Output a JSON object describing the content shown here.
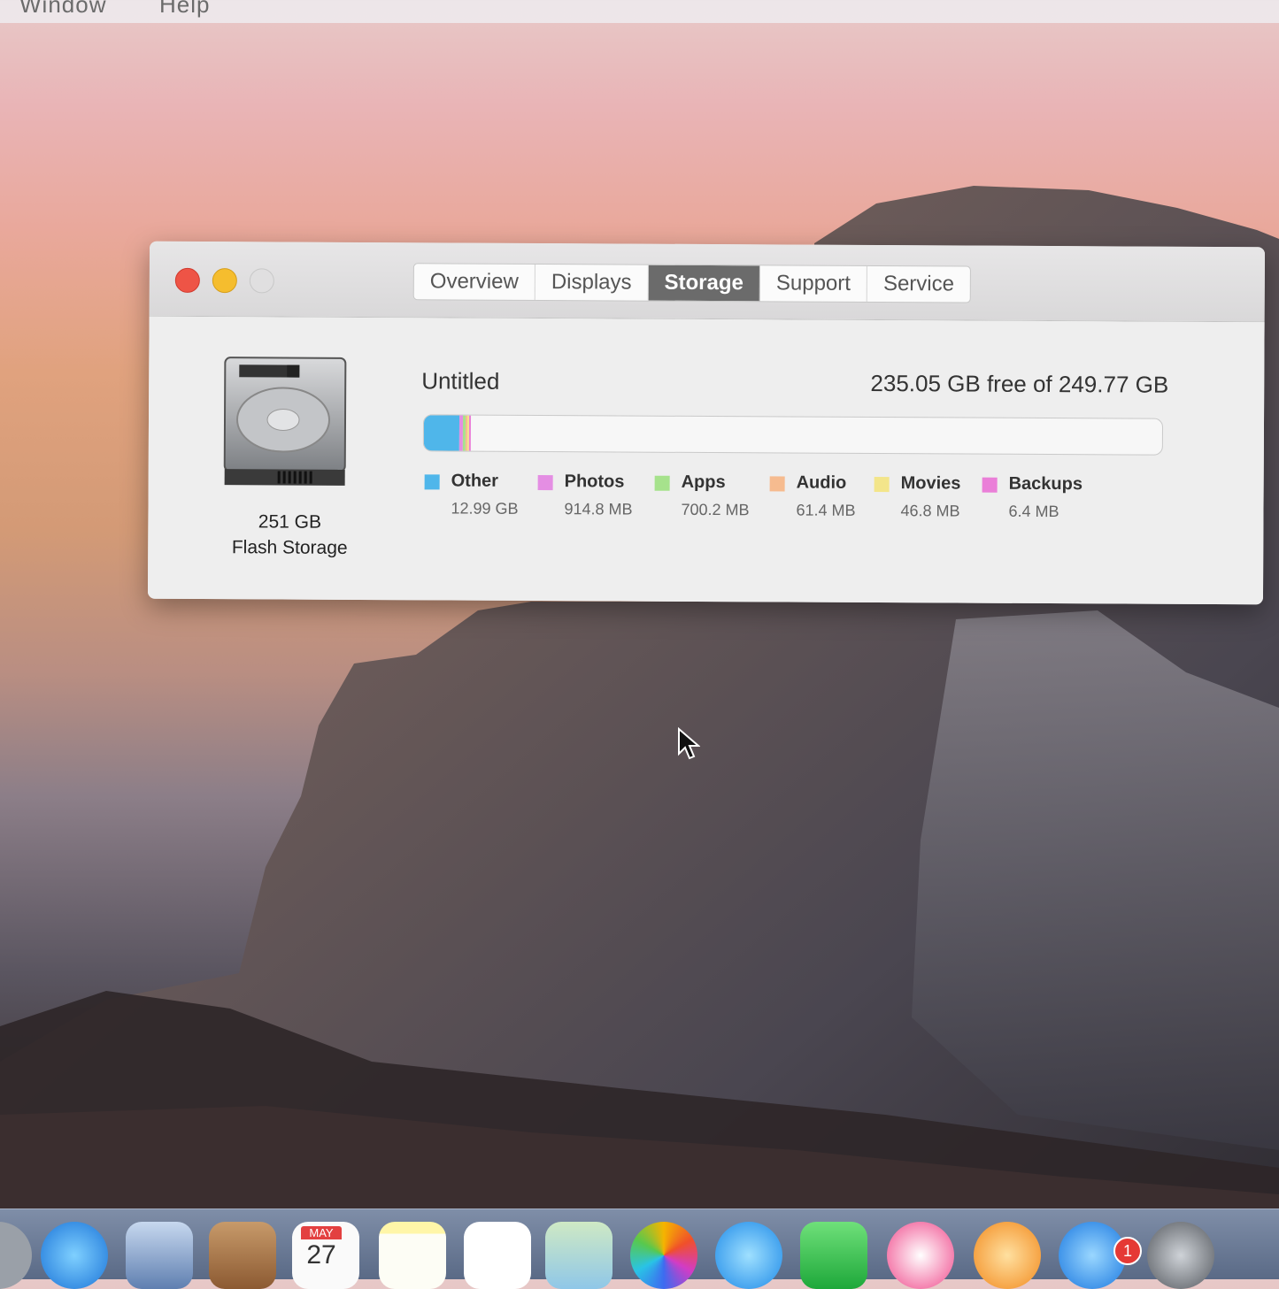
{
  "menubar": {
    "items": [
      "Window",
      "Help"
    ]
  },
  "window": {
    "tabs": [
      {
        "label": "Overview",
        "active": false
      },
      {
        "label": "Displays",
        "active": false
      },
      {
        "label": "Storage",
        "active": true
      },
      {
        "label": "Support",
        "active": false
      },
      {
        "label": "Service",
        "active": false
      }
    ],
    "disk": {
      "capacity": "251 GB",
      "type": "Flash Storage"
    },
    "volume": {
      "name": "Untitled",
      "free_text": "235.05 GB free of 249.77 GB",
      "usage_fraction": 0.059
    },
    "legend": [
      {
        "label": "Other",
        "value": "12.99 GB",
        "color": "#4fb6ea"
      },
      {
        "label": "Photos",
        "value": "914.8 MB",
        "color": "#e48ee3"
      },
      {
        "label": "Apps",
        "value": "700.2 MB",
        "color": "#a6e28c"
      },
      {
        "label": "Audio",
        "value": "61.4 MB",
        "color": "#f6bb8f"
      },
      {
        "label": "Movies",
        "value": "46.8 MB",
        "color": "#f3e58a"
      },
      {
        "label": "Backups",
        "value": "6.4 MB",
        "color": "#ea7fd8"
      }
    ]
  },
  "dock": {
    "calendar": {
      "month": "MAY",
      "day": "27"
    },
    "app_store_badge": "1",
    "icons": [
      "finder-icon",
      "safari-icon",
      "mail-icon",
      "contacts-icon",
      "calendar-icon",
      "notes-icon",
      "reminders-icon",
      "maps-icon",
      "photos-icon",
      "messages-icon",
      "facetime-icon",
      "itunes-icon",
      "ibooks-icon",
      "app-store-icon",
      "system-preferences-icon"
    ]
  }
}
